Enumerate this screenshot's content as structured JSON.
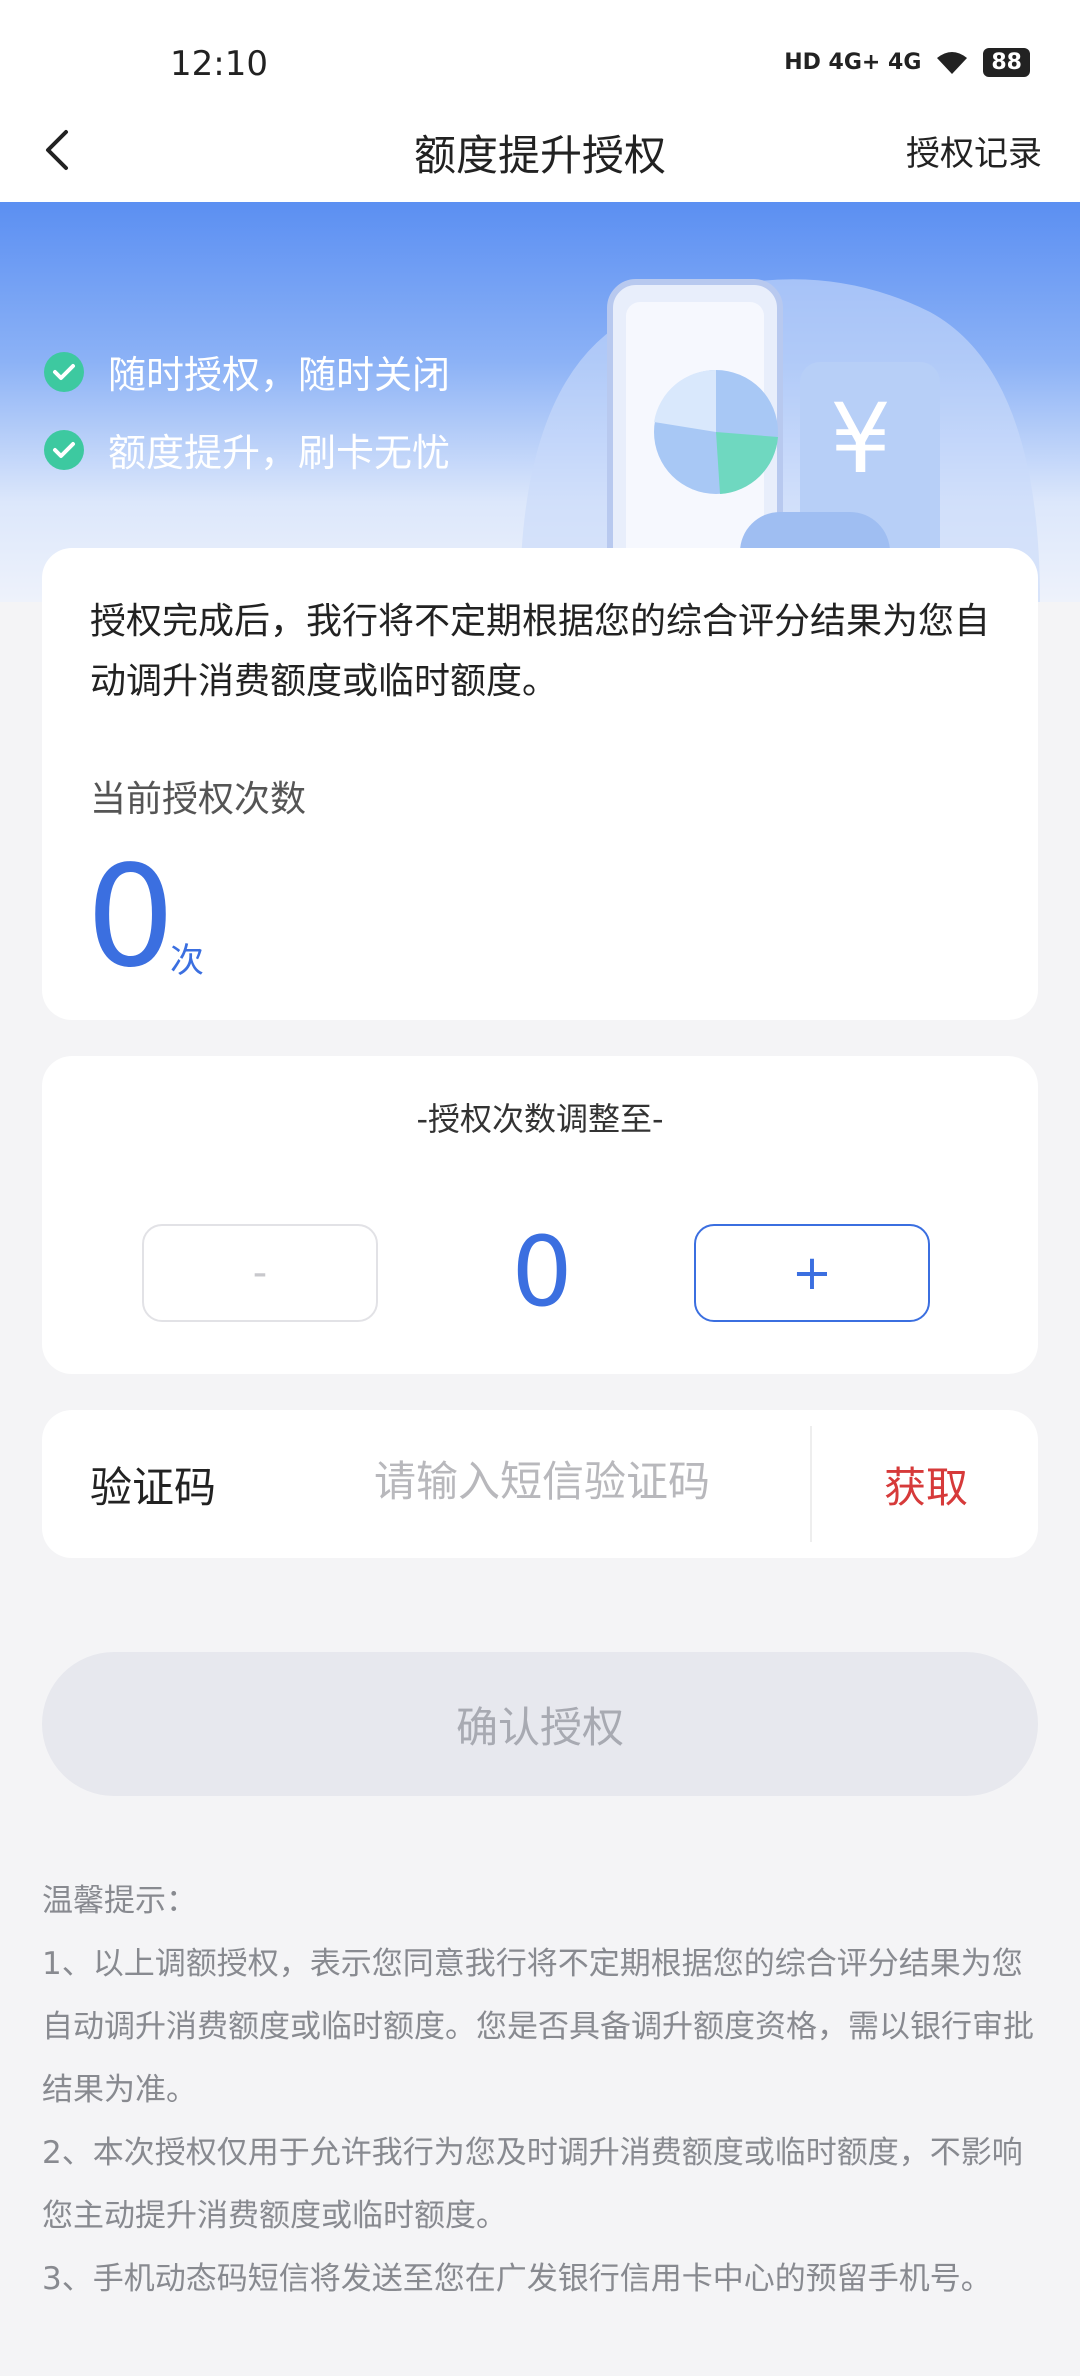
{
  "status_bar": {
    "time": "12:10",
    "signal_text": "HD 4G+ 4G",
    "battery": "88"
  },
  "nav": {
    "title": "额度提升授权",
    "right_link": "授权记录"
  },
  "banner": {
    "features": [
      "随时授权，随时关闭",
      "额度提升，刷卡无忧"
    ]
  },
  "info_card": {
    "description": "授权完成后，我行将不定期根据您的综合评分结果为您自动调升消费额度或临时额度。",
    "count_label": "当前授权次数",
    "count_value": "0",
    "count_unit": "次"
  },
  "adjust_card": {
    "title": "-授权次数调整至-",
    "minus_label": "-",
    "plus_label": "+",
    "value": "0"
  },
  "code_card": {
    "label": "验证码",
    "placeholder": "请输入短信验证码",
    "get_label": "获取"
  },
  "confirm_button": "确认授权",
  "tips": {
    "title": "温馨提示：",
    "items": [
      "1、以上调额授权，表示您同意我行将不定期根据您的综合评分结果为您自动调升消费额度或临时额度。您是否具备调升额度资格，需以银行审批结果为准。",
      "2、本次授权仅用于允许我行为您及时调升消费额度或临时额度，不影响您主动提升消费额度或临时额度。",
      "3、手机动态码短信将发送至您在广发银行信用卡中心的预留手机号。"
    ]
  },
  "colors": {
    "accent": "#3b6fe0",
    "danger": "#d63a3a",
    "check": "#3dc9a0"
  }
}
